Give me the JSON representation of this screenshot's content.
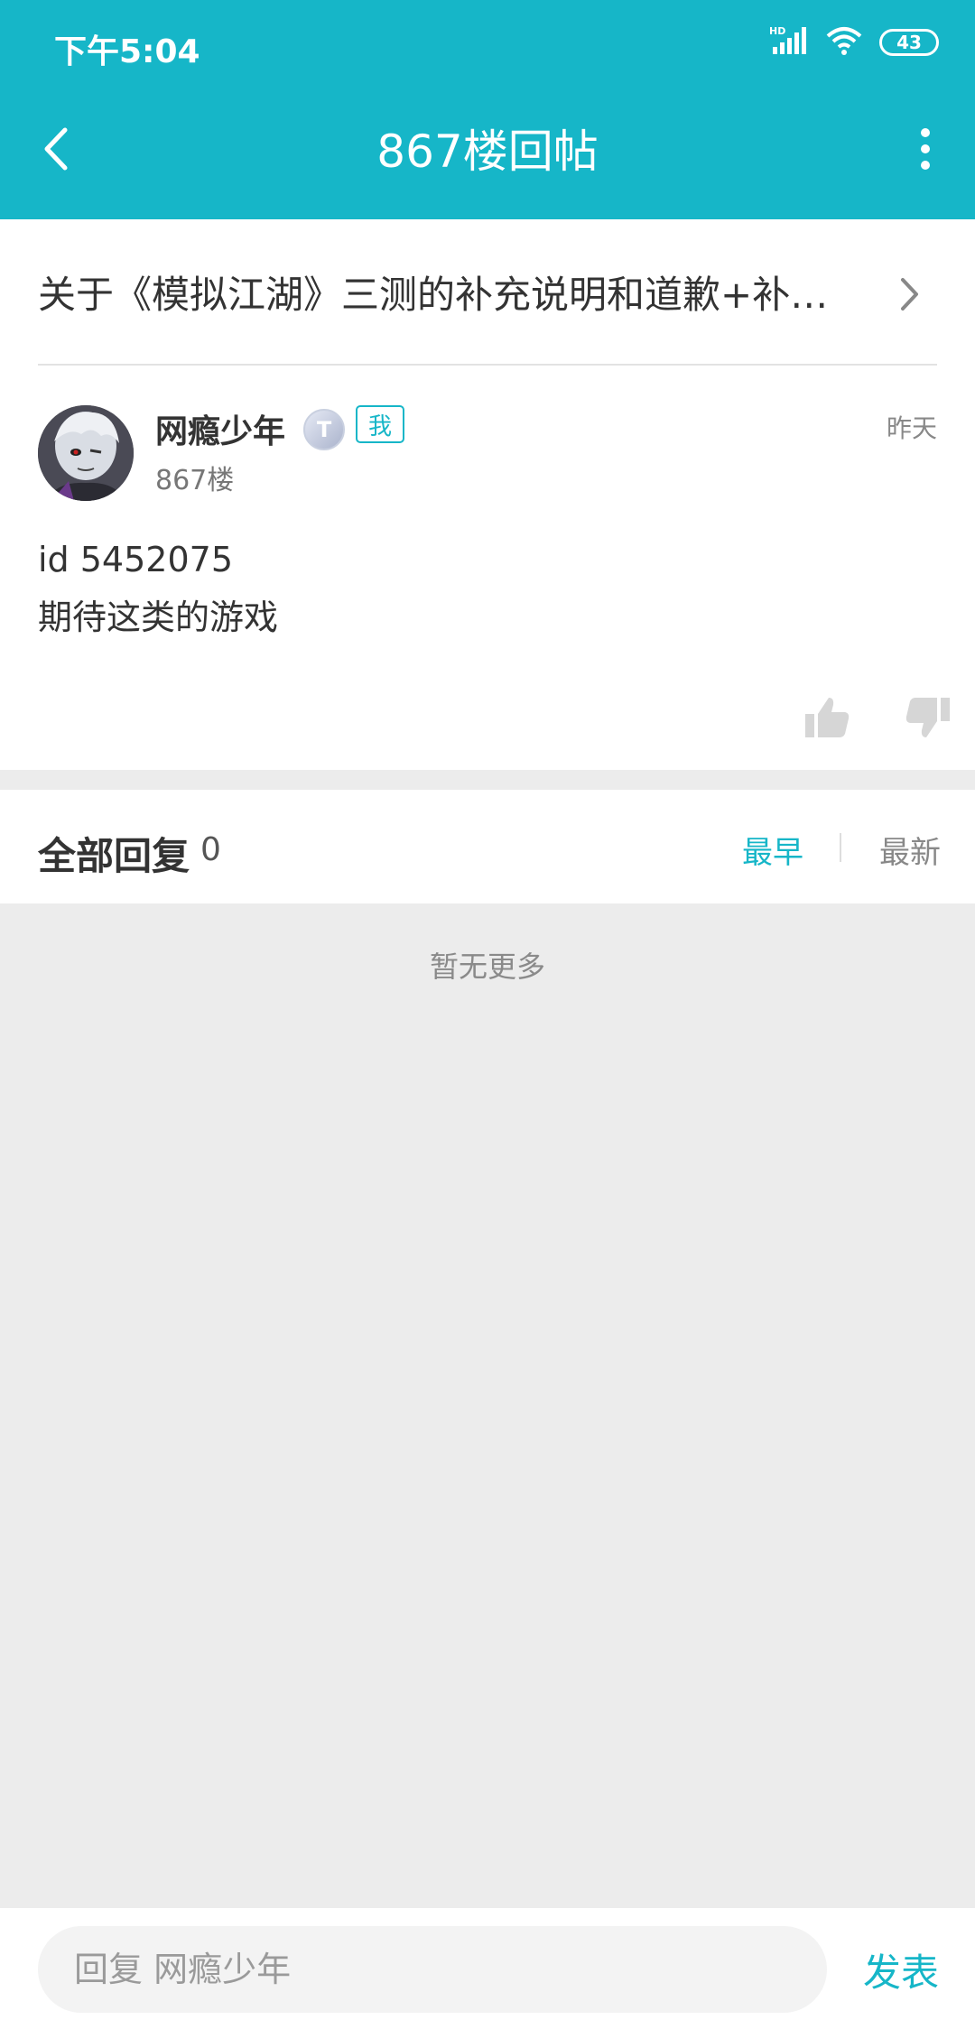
{
  "status_bar": {
    "time": "下午5:04",
    "battery": "43",
    "network_label": "HD"
  },
  "header": {
    "title": "867楼回帖"
  },
  "thread": {
    "title": "关于《模拟江湖》三测的补充说明和道歉+补…"
  },
  "post": {
    "username": "网瘾少年",
    "level_badge": "T",
    "me_badge": "我",
    "floor": "867楼",
    "time": "昨天",
    "content_lines": [
      "id 5452075",
      "期待这类的游戏"
    ]
  },
  "replies": {
    "title": "全部回复",
    "count": "0",
    "sort_earliest": "最早",
    "sort_latest": "最新"
  },
  "empty_text": "暂无更多",
  "reply_bar": {
    "placeholder": "回复 网瘾少年",
    "send_label": "发表"
  },
  "colors": {
    "accent": "#16b6c8",
    "background": "#ececec"
  }
}
